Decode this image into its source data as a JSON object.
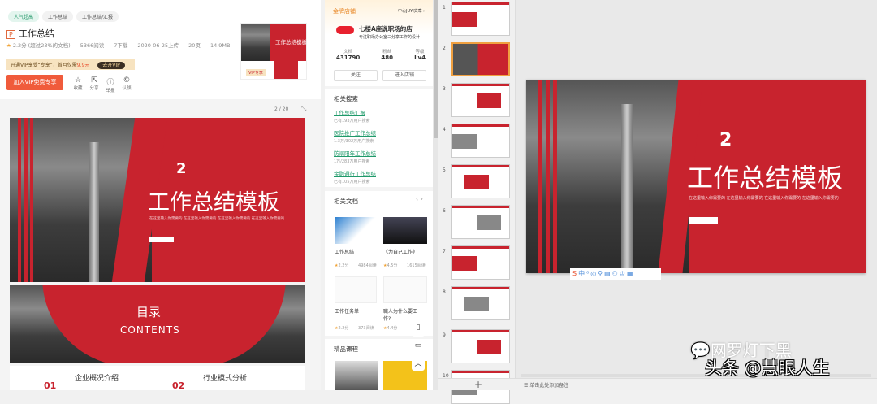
{
  "doc": {
    "tags": [
      "人气超高",
      "工作总结",
      "工作总结/汇报"
    ],
    "title": "工作总结",
    "rating": "2.2分",
    "rating_note": "(超过23%的文档)",
    "views": "5366阅读",
    "downloads": "7下载",
    "date": "2020-06-25上传",
    "pages": "20页",
    "size": "14.9MB",
    "vip_text": "开通VIP享受“专享”，首月仅需",
    "vip_price": "9.9元",
    "vip_btn": "去开VIP",
    "join_btn": "加入VIP免费专享",
    "actions": [
      {
        "icon": "star-icon",
        "glyph": "☆",
        "label": "收藏"
      },
      {
        "icon": "share-icon",
        "glyph": "⇱",
        "label": "分享"
      },
      {
        "icon": "report-icon",
        "glyph": "ⓘ",
        "label": "举报"
      },
      {
        "icon": "copyright-icon",
        "glyph": "©",
        "label": "认领"
      }
    ],
    "thumb_title": "工作总结模板",
    "vip_badge": "VIP专享"
  },
  "viewer": {
    "page": "2",
    "total": "/ 20",
    "slide1": {
      "num": "2",
      "title": "工作总结模板",
      "subtitle": "在这里输入你需要的  在这里输入你需要的  在这里输入你需要的  在这里输入你需要的"
    },
    "slide2": {
      "title": "目录",
      "subtitle": "CONTENTS"
    },
    "slide3": [
      {
        "num": "01",
        "title": "企业概况介绍"
      },
      {
        "num": "02",
        "title": "行业模式分析"
      }
    ]
  },
  "shop": {
    "header": "金牌店铺",
    "enter": "中心JUYI文章 ›",
    "name": "七楼A座说职场的店",
    "desc": "专注职场办公室三分享工作的设计",
    "stats": [
      {
        "label": "文档",
        "value": "431790"
      },
      {
        "label": "粉丝",
        "value": "480"
      },
      {
        "label": "等级",
        "value": "Lv4"
      }
    ],
    "follow": "关注",
    "visit": "进入店铺"
  },
  "related_search": {
    "title": "相关搜索",
    "items": [
      {
        "link": "工作总结汇报",
        "sub": "已有193万用户搜索"
      },
      {
        "link": "医院推广工作总结",
        "sub": "1.3万/302万用户搜索"
      },
      {
        "link": "防溺阳年工作总结",
        "sub": "1万/283万用户搜索"
      },
      {
        "link": "金融通行工作总结",
        "sub": "已有105万用户搜索"
      }
    ]
  },
  "related_docs": {
    "title": "相关文档",
    "items": [
      {
        "title": "工作总结",
        "rating": "2.2分",
        "views": "4984阅读"
      },
      {
        "title": "《为自己工作》",
        "rating": "4.5分",
        "views": "1615阅读"
      },
      {
        "title": "工作任务单",
        "rating": "2.2分",
        "views": "373阅读"
      },
      {
        "title": "職人为什么要工作?",
        "rating": "4.4分",
        "views": ""
      }
    ]
  },
  "courses": {
    "title": "精品课程"
  },
  "thumbs": [
    "1",
    "2",
    "3",
    "4",
    "5",
    "6",
    "7",
    "8",
    "9",
    "10"
  ],
  "editor": {
    "slide_num": "2",
    "slide_title": "工作总结模板",
    "slide_subtitle": "在这里输入你需要的  在这里输入你需要的  在这里输入你需要的  在这里输入你需要的",
    "add_slide": "+",
    "notes": "单击此处添加备注"
  },
  "watermark": {
    "line1": "网罗灯下黑",
    "line2": "头条 @慧眼人生"
  }
}
